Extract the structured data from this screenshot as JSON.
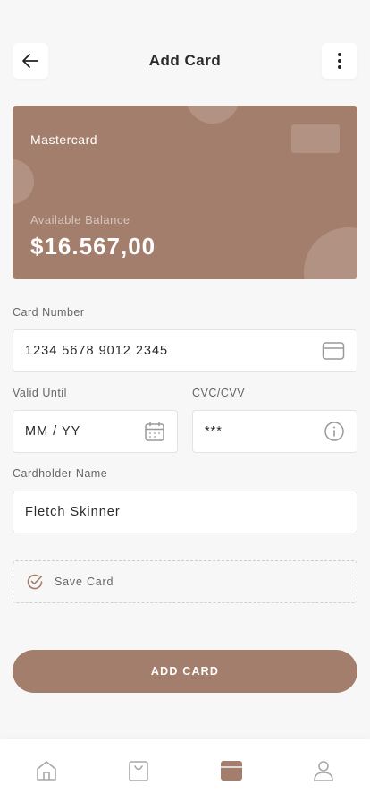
{
  "header": {
    "title": "Add Card",
    "back_icon": "arrow-left-icon",
    "menu_icon": "more-vertical-icon"
  },
  "card": {
    "brand": "Mastercard",
    "balance_label": "Available Balance",
    "balance_value": "$16.567,00",
    "color": "#a47e6c"
  },
  "form": {
    "card_number": {
      "label": "Card Number",
      "value": "1234 5678 9012 2345",
      "icon": "credit-card-icon"
    },
    "valid_until": {
      "label": "Valid Until",
      "placeholder": "MM / YY",
      "icon": "calendar-icon"
    },
    "cvc": {
      "label": "CVC/CVV",
      "value": "***",
      "icon": "info-icon"
    },
    "cardholder": {
      "label": "Cardholder Name",
      "value": "Fletch Skinner"
    },
    "save_card": {
      "label": "Save Card",
      "icon": "check-circle-icon"
    }
  },
  "actions": {
    "add_card_label": "ADD CARD"
  },
  "tabbar": {
    "items": [
      {
        "name": "home",
        "icon": "home-icon",
        "active": false
      },
      {
        "name": "shop",
        "icon": "shopping-bag-icon",
        "active": false
      },
      {
        "name": "cards",
        "icon": "card-icon",
        "active": true
      },
      {
        "name": "profile",
        "icon": "user-icon",
        "active": false
      }
    ],
    "active_color": "#a47e6c",
    "inactive_color": "#a8a8a8"
  }
}
